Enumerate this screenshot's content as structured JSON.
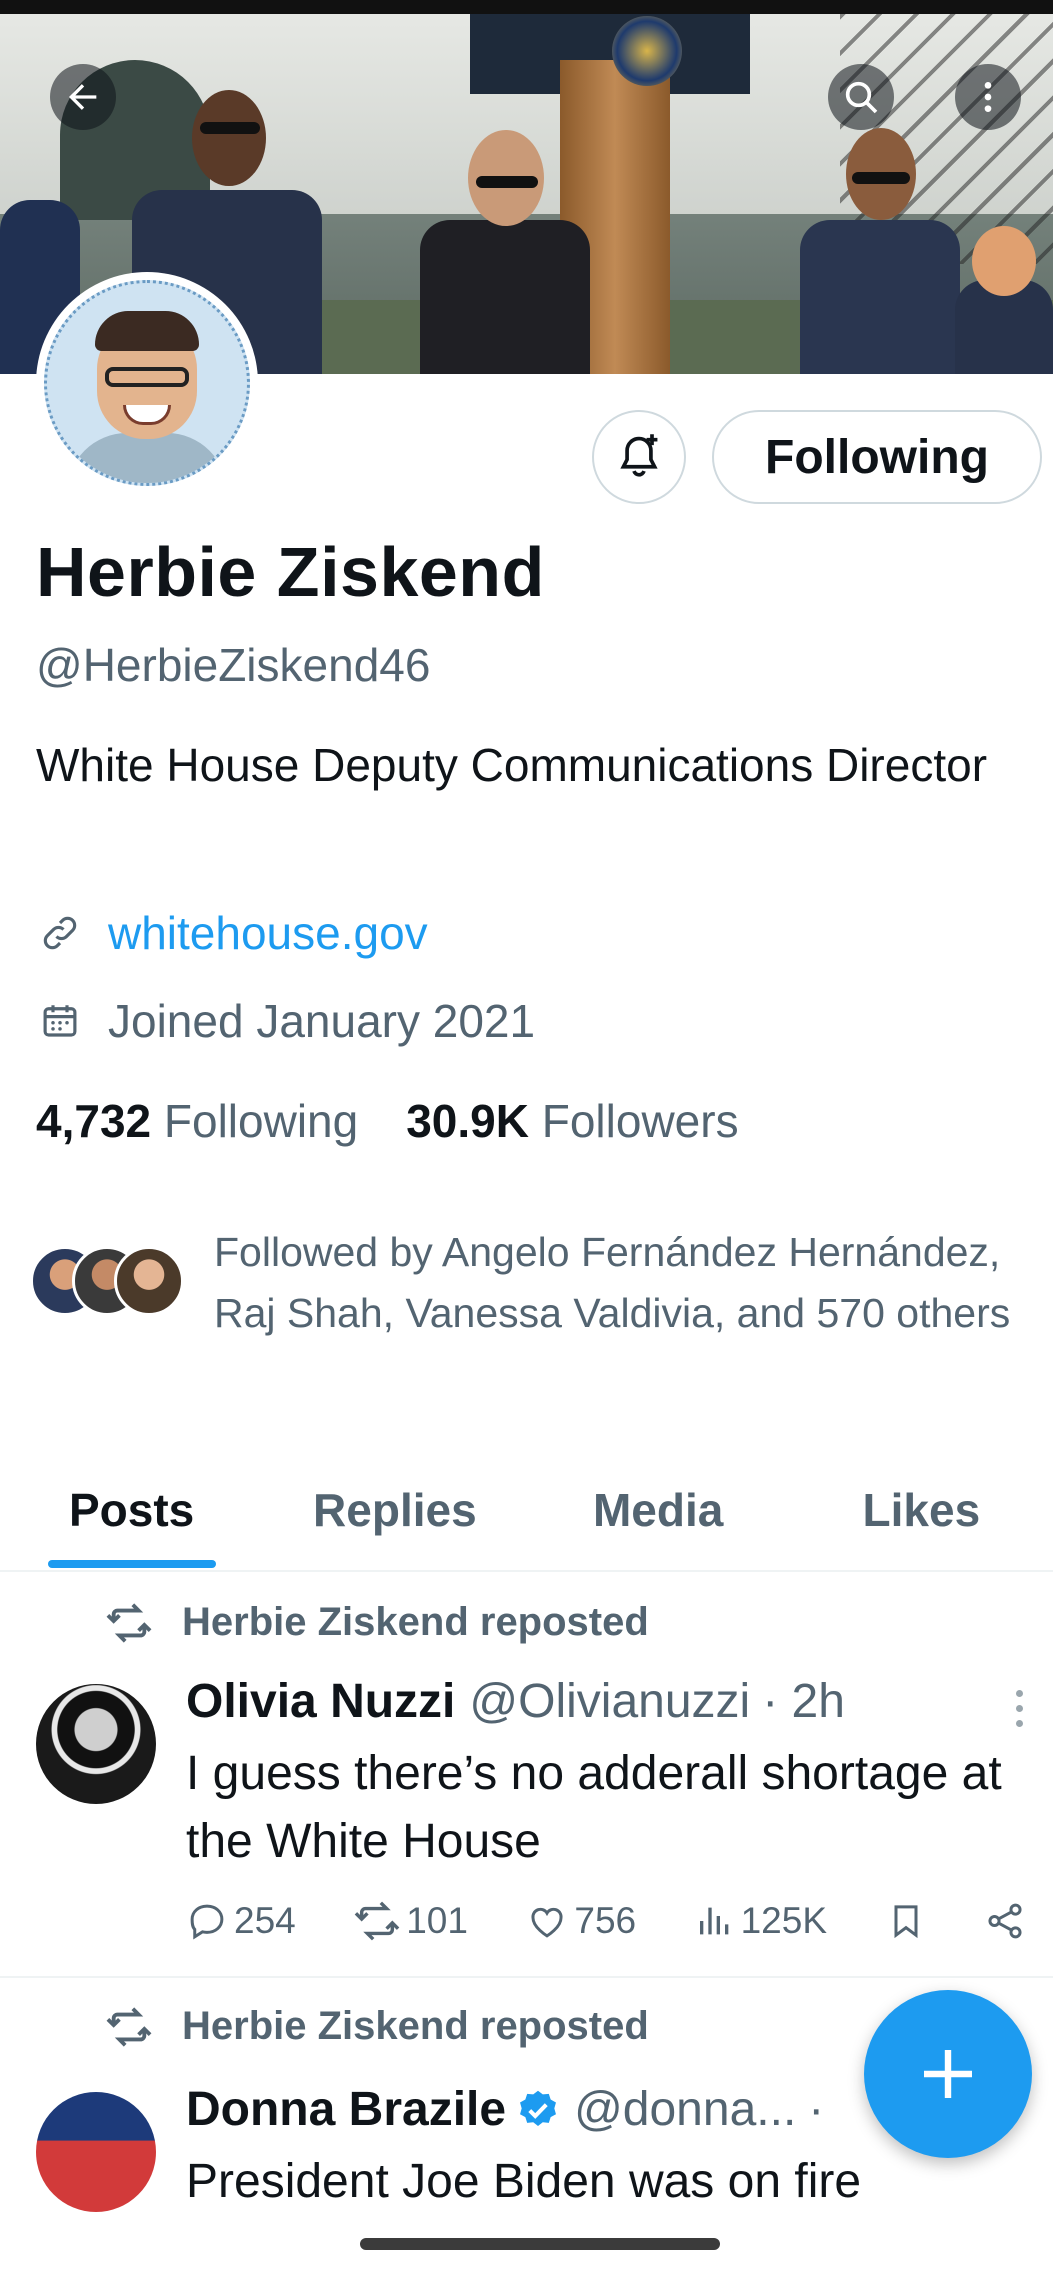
{
  "header": {
    "back_icon": "arrow-left-icon",
    "search_icon": "search-icon",
    "more_icon": "more-vertical-icon"
  },
  "profile": {
    "name": "Herbie Ziskend",
    "handle": "@HerbieZiskend46",
    "bio": "White House Deputy Communications Director",
    "link": "whitehouse.gov",
    "joined": "Joined January 2021",
    "following_count": "4,732",
    "following_label": "Following",
    "followers_count": "30.9K",
    "followers_label": "Followers",
    "followed_by": "Followed by Angelo Fernández Hernández, Raj Shah, Vanessa Valdivia, and 570 others",
    "follow_button": "Following"
  },
  "tabs": [
    {
      "label": "Posts",
      "active": true
    },
    {
      "label": "Replies",
      "active": false
    },
    {
      "label": "Media",
      "active": false
    },
    {
      "label": "Likes",
      "active": false
    }
  ],
  "posts": [
    {
      "repost_label": "Herbie Ziskend reposted",
      "author": "Olivia Nuzzi",
      "handle": "@Olivianuzzi",
      "time": "· 2h",
      "text": "I guess there’s no adderall shortage at the White House",
      "replies": "254",
      "reposts": "101",
      "likes": "756",
      "views": "125K"
    },
    {
      "repost_label": "Herbie Ziskend reposted",
      "author": "Donna Brazile",
      "handle": "@donna...",
      "time": "·",
      "text": "President Joe Biden was on fire"
    }
  ],
  "colors": {
    "accent": "#1d9bf0",
    "text_primary": "#0f1419",
    "text_secondary": "#536471",
    "border": "#cfd9de"
  }
}
